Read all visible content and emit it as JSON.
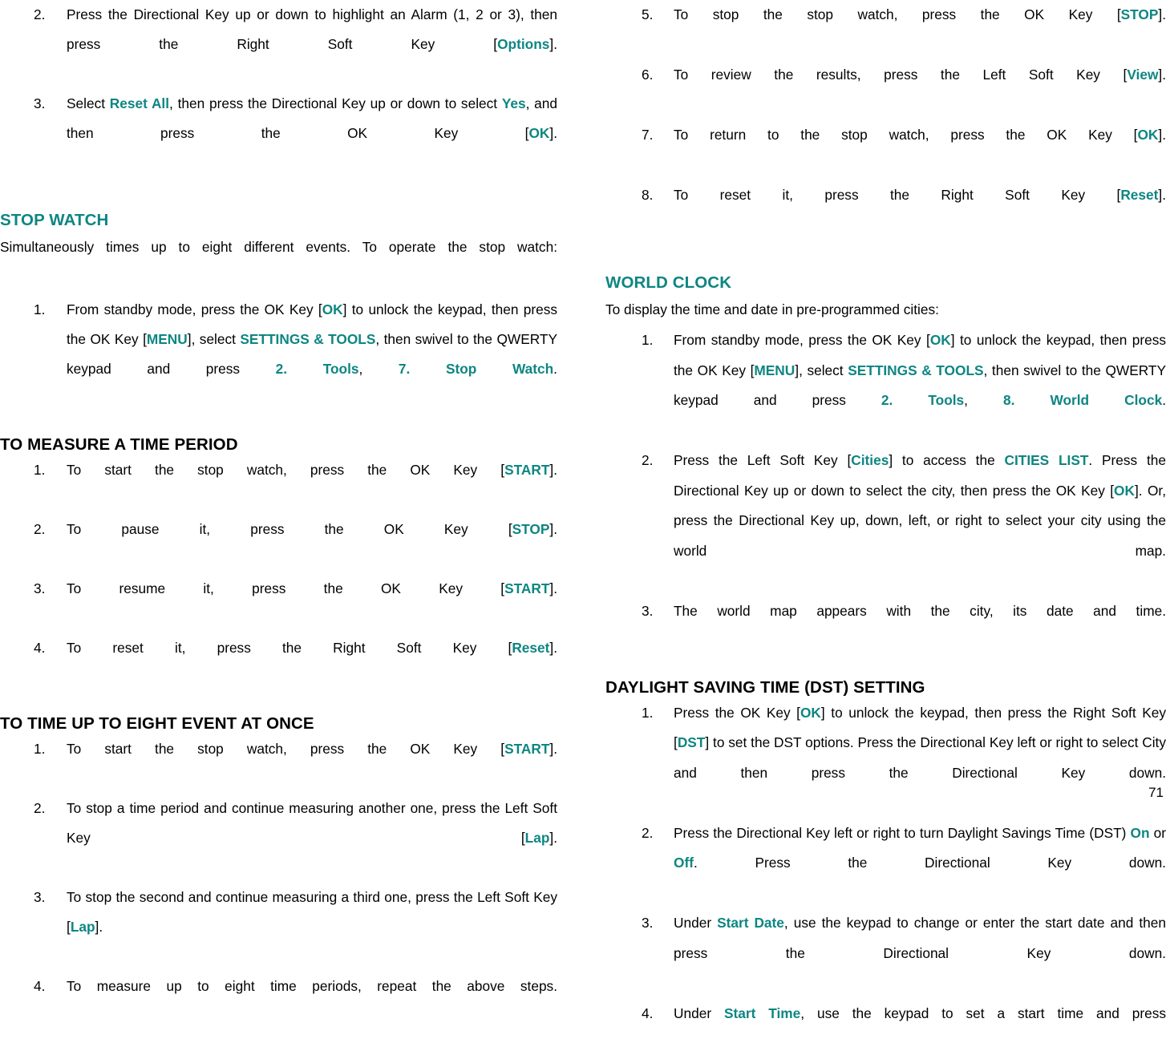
{
  "page": {
    "number": "71",
    "accent_color": "#0d8682",
    "text_color": "#000000",
    "background_color": "#ffffff"
  },
  "left_column": {
    "alarm_steps": [
      {
        "num": "2.",
        "runs": [
          {
            "text": "Press the Directional Key up or down to highlight an Alarm (1, 2 or 3), then press the Right Soft Key [",
            "style": "plain"
          },
          {
            "text": "Options",
            "style": "accent"
          },
          {
            "text": "].",
            "style": "plain"
          }
        ]
      },
      {
        "num": "3.",
        "runs": [
          {
            "text": "Select ",
            "style": "plain"
          },
          {
            "text": "Reset All",
            "style": "accent"
          },
          {
            "text": ", then press the Directional Key up or down to select ",
            "style": "plain"
          },
          {
            "text": "Yes",
            "style": "accent"
          },
          {
            "text": ", and then press the OK Key [",
            "style": "plain"
          },
          {
            "text": "OK",
            "style": "accent"
          },
          {
            "text": "].",
            "style": "plain"
          }
        ]
      }
    ],
    "stop_watch": {
      "heading": "STOP WATCH",
      "heading_color": "accent",
      "intro": "Simultaneously times up to eight different events. To operate the stop watch:",
      "steps": [
        {
          "num": "1.",
          "runs": [
            {
              "text": "From standby mode, press the OK Key [",
              "style": "plain"
            },
            {
              "text": "OK",
              "style": "accent"
            },
            {
              "text": "] to unlock the keypad, then press the OK Key [",
              "style": "plain"
            },
            {
              "text": "MENU",
              "style": "accent"
            },
            {
              "text": "], select ",
              "style": "plain"
            },
            {
              "text": "SETTINGS & TOOLS",
              "style": "accent"
            },
            {
              "text": ", then swivel to the QWERTY keypad and press ",
              "style": "plain"
            },
            {
              "text": "2. Tools",
              "style": "accent"
            },
            {
              "text": ", ",
              "style": "plain"
            },
            {
              "text": "7. Stop Watch",
              "style": "accent"
            },
            {
              "text": ".",
              "style": "plain"
            }
          ]
        }
      ]
    },
    "measure_time_period": {
      "heading": "TO MEASURE A TIME PERIOD",
      "heading_color": "black",
      "steps": [
        {
          "num": "1.",
          "runs": [
            {
              "text": "To start the stop watch, press the OK Key [",
              "style": "plain"
            },
            {
              "text": "START",
              "style": "accent"
            },
            {
              "text": "].",
              "style": "plain"
            }
          ]
        },
        {
          "num": "2.",
          "runs": [
            {
              "text": "To pause it, press the OK Key [",
              "style": "plain"
            },
            {
              "text": "STOP",
              "style": "accent"
            },
            {
              "text": "].",
              "style": "plain"
            }
          ]
        },
        {
          "num": "3.",
          "runs": [
            {
              "text": "To resume it, press the OK Key [",
              "style": "plain"
            },
            {
              "text": "START",
              "style": "accent"
            },
            {
              "text": "].",
              "style": "plain"
            }
          ]
        },
        {
          "num": "4.",
          "runs": [
            {
              "text": "To reset it, press the Right Soft Key [",
              "style": "plain"
            },
            {
              "text": "Reset",
              "style": "accent"
            },
            {
              "text": "].",
              "style": "plain"
            }
          ]
        }
      ]
    },
    "time_eight_events": {
      "heading": "TO TIME UP TO EIGHT EVENT AT ONCE",
      "heading_color": "black",
      "steps": [
        {
          "num": "1.",
          "runs": [
            {
              "text": "To start the stop watch, press the OK Key [",
              "style": "plain"
            },
            {
              "text": "START",
              "style": "accent"
            },
            {
              "text": "].",
              "style": "plain"
            }
          ]
        },
        {
          "num": "2.",
          "runs": [
            {
              "text": "To stop a time period and continue measuring another one, press the Left Soft Key [",
              "style": "plain"
            },
            {
              "text": "Lap",
              "style": "accent"
            },
            {
              "text": "].",
              "style": "plain"
            }
          ]
        },
        {
          "num": "3.",
          "runs": [
            {
              "text": "To stop the second and continue measuring a third one, press the Left Soft Key [",
              "style": "plain"
            },
            {
              "text": "Lap",
              "style": "accent"
            },
            {
              "text": "].",
              "style": "plain"
            }
          ]
        },
        {
          "num": "4.",
          "runs": [
            {
              "text": "To measure up to eight time periods, repeat the above steps.",
              "style": "plain"
            }
          ]
        }
      ]
    }
  },
  "right_column": {
    "stop_watch_steps": [
      {
        "num": "5.",
        "runs": [
          {
            "text": "To stop the stop watch, press the OK Key [",
            "style": "plain"
          },
          {
            "text": "STOP",
            "style": "accent"
          },
          {
            "text": "].",
            "style": "plain"
          }
        ]
      },
      {
        "num": "6.",
        "runs": [
          {
            "text": "To review the results, press the Left Soft Key [",
            "style": "plain"
          },
          {
            "text": "View",
            "style": "accent"
          },
          {
            "text": "].",
            "style": "plain"
          }
        ]
      },
      {
        "num": "7.",
        "runs": [
          {
            "text": "To return to the stop watch, press the OK Key [",
            "style": "plain"
          },
          {
            "text": "OK",
            "style": "accent"
          },
          {
            "text": "].",
            "style": "plain"
          }
        ]
      },
      {
        "num": "8.",
        "runs": [
          {
            "text": "To reset it, press the Right Soft Key [",
            "style": "plain"
          },
          {
            "text": "Reset",
            "style": "accent"
          },
          {
            "text": "].",
            "style": "plain"
          }
        ]
      }
    ],
    "world_clock": {
      "heading": "WORLD CLOCK",
      "heading_color": "accent",
      "intro": "To display the time and date in pre-programmed cities:",
      "steps": [
        {
          "num": "1.",
          "runs": [
            {
              "text": "From standby mode, press the OK Key [",
              "style": "plain"
            },
            {
              "text": "OK",
              "style": "accent"
            },
            {
              "text": "] to unlock the keypad, then press the OK Key [",
              "style": "plain"
            },
            {
              "text": "MENU",
              "style": "accent"
            },
            {
              "text": "], select ",
              "style": "plain"
            },
            {
              "text": "SETTINGS & TOOLS",
              "style": "accent"
            },
            {
              "text": ", then swivel to the QWERTY keypad and press ",
              "style": "plain"
            },
            {
              "text": "2. Tools",
              "style": "accent"
            },
            {
              "text": ", ",
              "style": "plain"
            },
            {
              "text": "8. World Clock",
              "style": "accent"
            },
            {
              "text": ".",
              "style": "plain"
            }
          ]
        },
        {
          "num": "2.",
          "runs": [
            {
              "text": "Press the Left Soft Key [",
              "style": "plain"
            },
            {
              "text": "Cities",
              "style": "accent"
            },
            {
              "text": "] to access the ",
              "style": "plain"
            },
            {
              "text": "CITIES LIST",
              "style": "accent"
            },
            {
              "text": ". Press the Directional Key up or down to select the city, then press the OK Key [",
              "style": "plain"
            },
            {
              "text": "OK",
              "style": "accent"
            },
            {
              "text": "]. Or, press the Directional Key up, down, left, or right to select your city using the world map.",
              "style": "plain"
            }
          ]
        },
        {
          "num": "3.",
          "runs": [
            {
              "text": "The world map appears with the city, its date and time.",
              "style": "plain"
            }
          ]
        }
      ]
    },
    "dst_setting": {
      "heading": "DAYLIGHT SAVING TIME (DST) SETTING",
      "heading_color": "black",
      "steps": [
        {
          "num": "1.",
          "runs": [
            {
              "text": "Press the OK Key [",
              "style": "plain"
            },
            {
              "text": "OK",
              "style": "accent"
            },
            {
              "text": "] to unlock the keypad, then press the Right Soft Key [",
              "style": "plain"
            },
            {
              "text": "DST",
              "style": "accent"
            },
            {
              "text": "] to set the DST options. Press the Directional Key left or right to select City and then press the Directional Key down.",
              "style": "plain"
            }
          ]
        },
        {
          "num": "2.",
          "runs": [
            {
              "text": "Press the Directional Key left or right to turn Daylight Savings Time (DST) ",
              "style": "plain"
            },
            {
              "text": "On",
              "style": "accent"
            },
            {
              "text": " or ",
              "style": "plain"
            },
            {
              "text": "Off",
              "style": "accent"
            },
            {
              "text": ". Press the Directional Key down.",
              "style": "plain"
            }
          ]
        },
        {
          "num": "3.",
          "runs": [
            {
              "text": "Under ",
              "style": "plain"
            },
            {
              "text": "Start Date",
              "style": "accent"
            },
            {
              "text": ", use the keypad to change or enter the start date and then press the Directional Key down.",
              "style": "plain"
            }
          ]
        },
        {
          "num": "4.",
          "runs": [
            {
              "text": "Under ",
              "style": "plain"
            },
            {
              "text": "Start Time",
              "style": "accent"
            },
            {
              "text": ", use the keypad to set a start time and press",
              "style": "plain"
            }
          ]
        }
      ]
    }
  }
}
